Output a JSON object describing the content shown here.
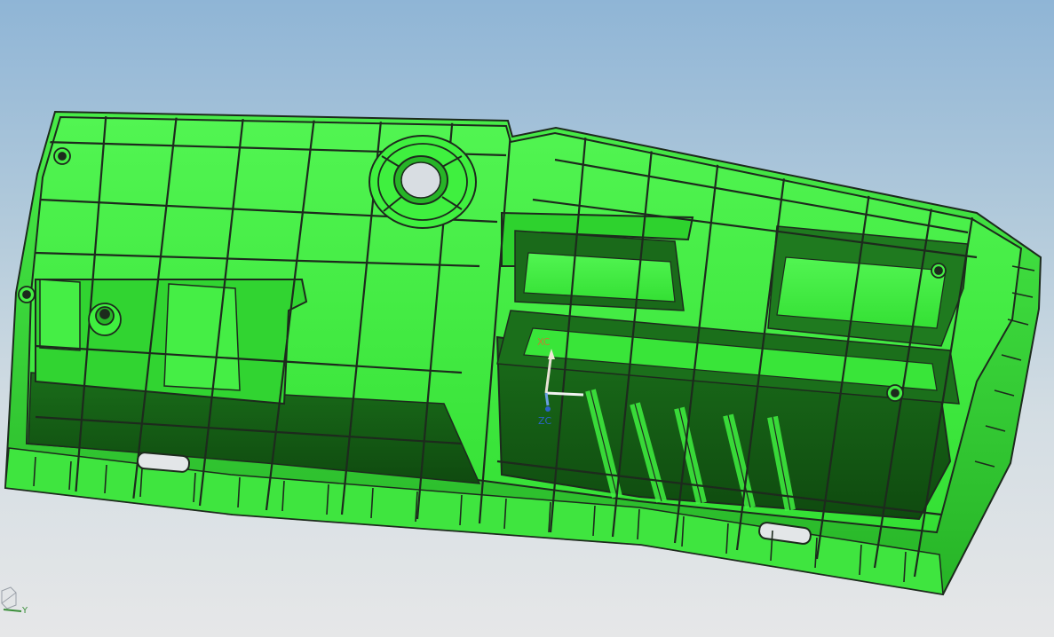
{
  "viewport": {
    "background_top": "#8fb5d6",
    "background_bottom": "#e6e7e8"
  },
  "model": {
    "shaded_color": "#3ff03f",
    "wall_shadow_color": "#0f4a0f",
    "edge_color": "#1d2a1d"
  },
  "work_csys": {
    "x_label": "XC",
    "z_label": "ZC",
    "x_color": "#c07f33",
    "z_color": "#2a63c8"
  },
  "view_triad": {
    "y_label": "Y",
    "y_color": "#3a8f3a"
  }
}
